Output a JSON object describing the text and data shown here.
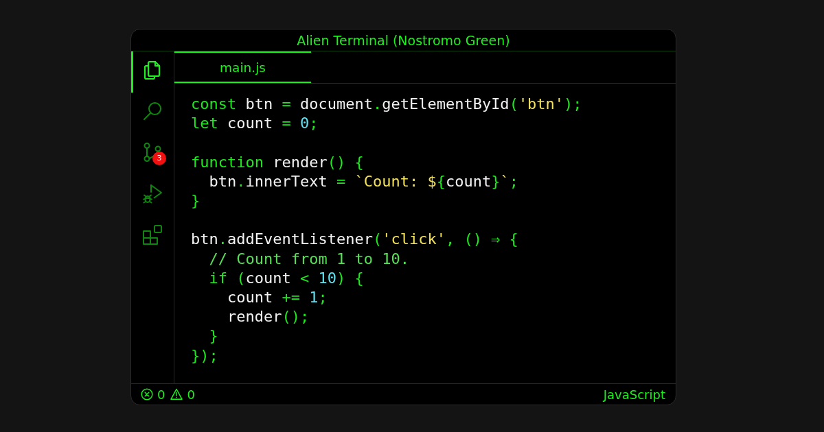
{
  "window": {
    "title": "Alien Terminal (Nostromo Green)"
  },
  "activity_bar": {
    "items": [
      {
        "kind": "files",
        "selected": true
      },
      {
        "kind": "search",
        "selected": false
      },
      {
        "kind": "source_control",
        "selected": false,
        "badge": "3"
      },
      {
        "kind": "run_debug",
        "selected": false
      },
      {
        "kind": "extensions",
        "selected": false
      }
    ]
  },
  "tabs": [
    {
      "label": "main.js",
      "selected": true
    }
  ],
  "editor": {
    "blocks": [
      [
        {
          "tokens": [
            {
              "text": "const",
              "kind": "keyword"
            },
            {
              "text": " btn ",
              "kind": "ident"
            },
            {
              "text": "=",
              "kind": "op"
            },
            {
              "text": " document",
              "kind": "ident"
            },
            {
              "text": ".",
              "kind": "op"
            },
            {
              "text": "getElementById",
              "kind": "ident"
            },
            {
              "text": "(",
              "kind": "op"
            },
            {
              "text": "'btn'",
              "kind": "string"
            },
            {
              "text": ");",
              "kind": "op"
            }
          ]
        },
        {
          "tokens": [
            {
              "text": "let",
              "kind": "keyword"
            },
            {
              "text": " count ",
              "kind": "ident"
            },
            {
              "text": "= ",
              "kind": "op"
            },
            {
              "text": "0",
              "kind": "number"
            },
            {
              "text": ";",
              "kind": "op"
            }
          ]
        }
      ],
      [
        {
          "tokens": [
            {
              "text": "function",
              "kind": "keyword"
            },
            {
              "text": " render",
              "kind": "ident"
            },
            {
              "text": "() {",
              "kind": "op"
            }
          ],
          "children": [
            {
              "tokens": [
                {
                  "text": "btn",
                  "kind": "ident"
                },
                {
                  "text": ".",
                  "kind": "op"
                },
                {
                  "text": "innerText ",
                  "kind": "ident"
                },
                {
                  "text": "= ",
                  "kind": "op"
                },
                {
                  "text": "`Count: $",
                  "kind": "string"
                },
                {
                  "text": "{",
                  "kind": "op"
                },
                {
                  "text": "count",
                  "kind": "ident"
                },
                {
                  "text": "}",
                  "kind": "op"
                },
                {
                  "text": "`",
                  "kind": "string"
                },
                {
                  "text": ";",
                  "kind": "op"
                }
              ]
            }
          ]
        },
        {
          "tokens": [
            {
              "text": "}",
              "kind": "op"
            }
          ]
        }
      ],
      [
        {
          "tokens": [
            {
              "text": "btn",
              "kind": "ident"
            },
            {
              "text": ".",
              "kind": "op"
            },
            {
              "text": "addEventListener",
              "kind": "ident"
            },
            {
              "text": "(",
              "kind": "op"
            },
            {
              "text": "'click'",
              "kind": "string"
            },
            {
              "text": ", () ⇒ {",
              "kind": "op"
            }
          ],
          "children": [
            {
              "tokens": [
                {
                  "text": "// Count from 1 to 10.",
                  "kind": "comment"
                }
              ]
            },
            {
              "tokens": [
                {
                  "text": "if",
                  "kind": "keyword"
                },
                {
                  "text": " (",
                  "kind": "op"
                },
                {
                  "text": "count ",
                  "kind": "ident"
                },
                {
                  "text": "< ",
                  "kind": "op"
                },
                {
                  "text": "10",
                  "kind": "number"
                },
                {
                  "text": ") {",
                  "kind": "op"
                }
              ],
              "children": [
                {
                  "tokens": [
                    {
                      "text": "count ",
                      "kind": "ident"
                    },
                    {
                      "text": "+= ",
                      "kind": "op"
                    },
                    {
                      "text": "1",
                      "kind": "number"
                    },
                    {
                      "text": ";",
                      "kind": "op"
                    }
                  ]
                },
                {
                  "tokens": [
                    {
                      "text": "render",
                      "kind": "ident"
                    },
                    {
                      "text": "();",
                      "kind": "op"
                    }
                  ]
                }
              ]
            },
            {
              "tokens": [
                {
                  "text": "}",
                  "kind": "op"
                }
              ]
            }
          ]
        },
        {
          "tokens": [
            {
              "text": "});",
              "kind": "op"
            }
          ]
        }
      ]
    ]
  },
  "status_bar": {
    "errors": "0",
    "warnings": "0",
    "language": "JavaScript"
  }
}
